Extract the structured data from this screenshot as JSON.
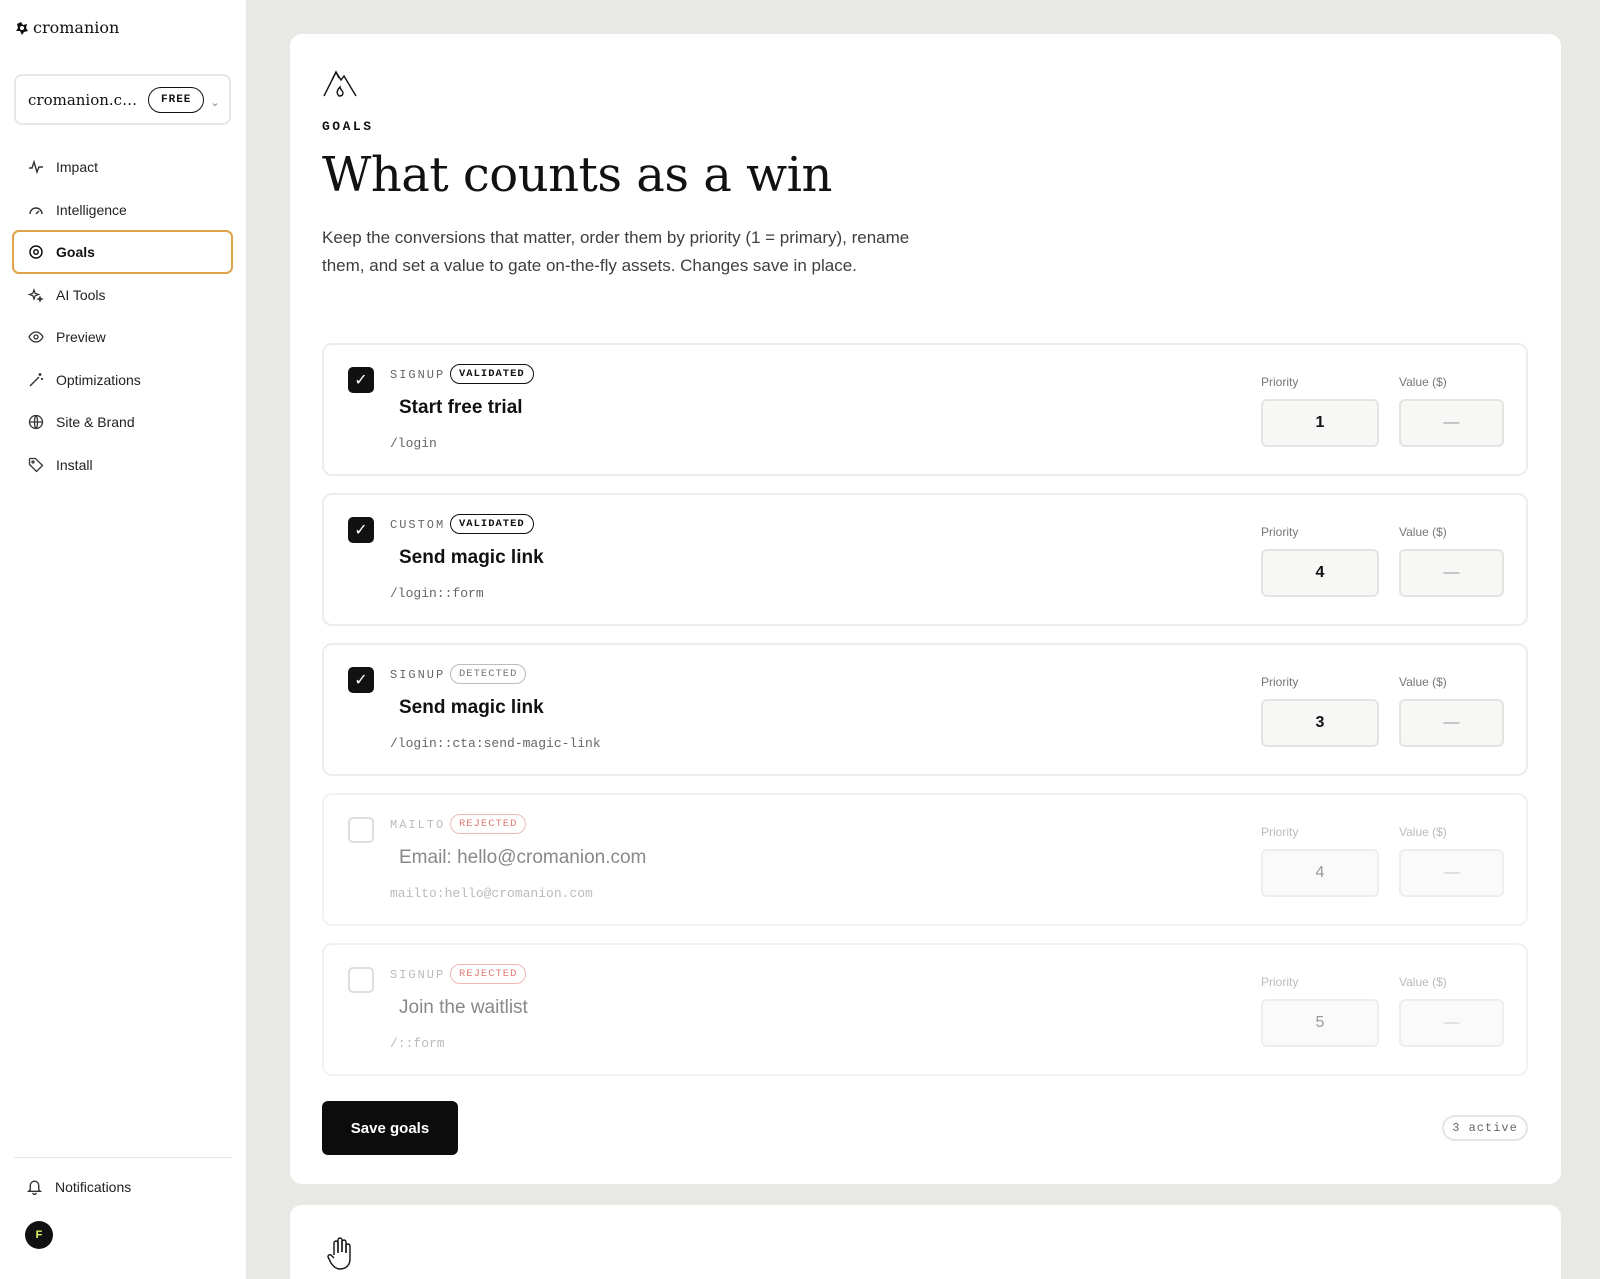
{
  "brand": {
    "name": "cromanion"
  },
  "workspace": {
    "name": "cromanion.co...",
    "plan": "FREE"
  },
  "nav": {
    "items": [
      {
        "label": "Impact",
        "icon": "activity-icon"
      },
      {
        "label": "Intelligence",
        "icon": "gauge-icon"
      },
      {
        "label": "Goals",
        "icon": "target-icon",
        "active": true
      },
      {
        "label": "AI Tools",
        "icon": "sparkles-icon"
      },
      {
        "label": "Preview",
        "icon": "eye-icon"
      },
      {
        "label": "Optimizations",
        "icon": "wand-icon"
      },
      {
        "label": "Site & Brand",
        "icon": "globe-icon"
      },
      {
        "label": "Install",
        "icon": "tag-icon"
      }
    ],
    "notifications": "Notifications",
    "user_initial": "F"
  },
  "page": {
    "eyebrow": "GOALS",
    "title": "What counts as a win",
    "description": "Keep the conversions that matter, order them by priority (1 = primary), rename them, and set a value to gate on-the-fly assets. Changes save in place."
  },
  "labels": {
    "priority": "Priority",
    "value": "Value ($)"
  },
  "goals": [
    {
      "checked": true,
      "type": "SIGNUP",
      "status": "VALIDATED",
      "name": "Start free trial",
      "path": "/login",
      "priority": "1",
      "value": "—"
    },
    {
      "checked": true,
      "type": "CUSTOM",
      "status": "VALIDATED",
      "name": "Send magic link",
      "path": "/login::form",
      "priority": "4",
      "value": "—"
    },
    {
      "checked": true,
      "type": "SIGNUP",
      "status": "DETECTED",
      "name": "Send magic link",
      "path": "/login::cta:send-magic-link",
      "priority": "3",
      "value": "—"
    },
    {
      "checked": false,
      "type": "MAILTO",
      "status": "REJECTED",
      "name": "Email: hello@cromanion.com",
      "path": "mailto:hello@cromanion.com",
      "priority": "4",
      "value": "—"
    },
    {
      "checked": false,
      "type": "SIGNUP",
      "status": "REJECTED",
      "name": "Join the waitlist",
      "path": "/::form",
      "priority": "5",
      "value": "—"
    }
  ],
  "footer": {
    "save_label": "Save goals",
    "active_count": "3 active"
  },
  "colors": {
    "accent": "#e0a34a",
    "primary": "#0c0c0c",
    "rejected": "#e07b75"
  }
}
